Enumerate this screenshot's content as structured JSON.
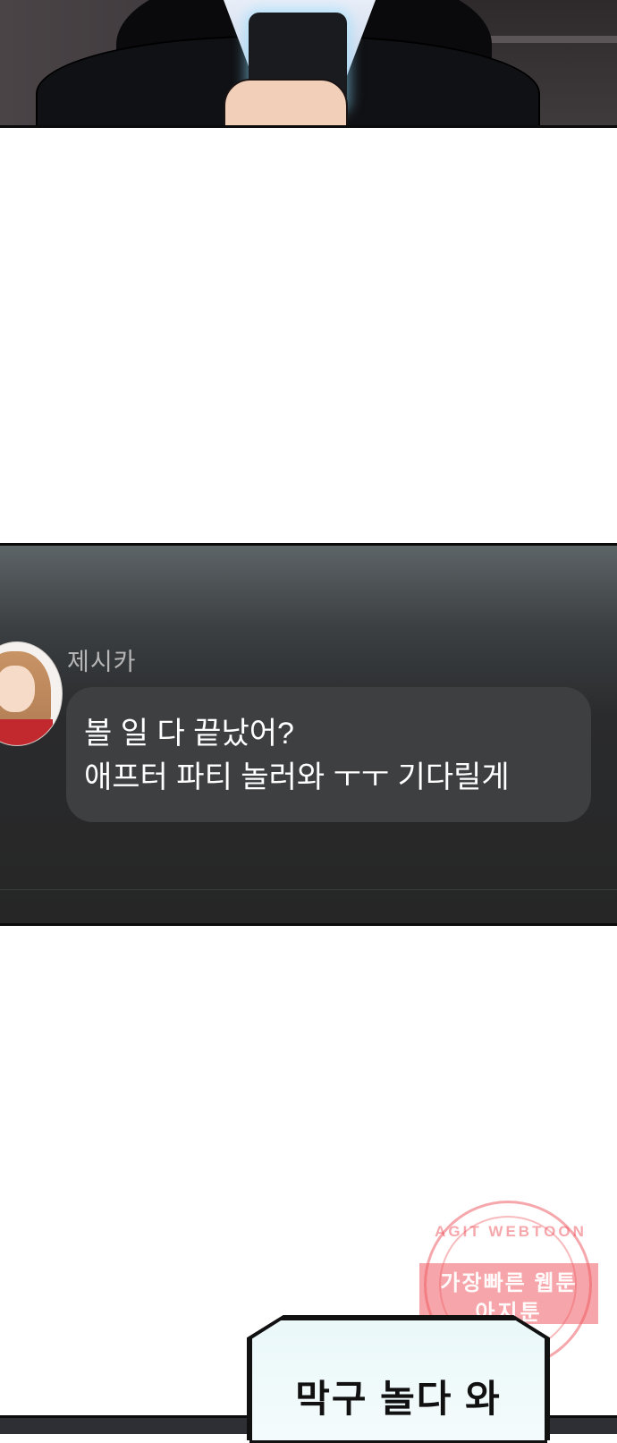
{
  "chat": {
    "sender_name": "제시카",
    "message_lines": [
      "볼 일 다 끝났어?",
      "애프터 파티 놀러와 ㅜㅜ 기다릴게"
    ]
  },
  "watermark": {
    "arc_text": "AGIT WEBTOON",
    "line1": "가장빠른 웹툰",
    "line2": "아지툰"
  },
  "caption": {
    "text": "막구 놀다 와"
  },
  "colors": {
    "chat_bg": "#262626",
    "bubble_bg": "#3e3f41",
    "stamp_red": "#eb3c46",
    "caption_bg": "#eaf8f9"
  }
}
